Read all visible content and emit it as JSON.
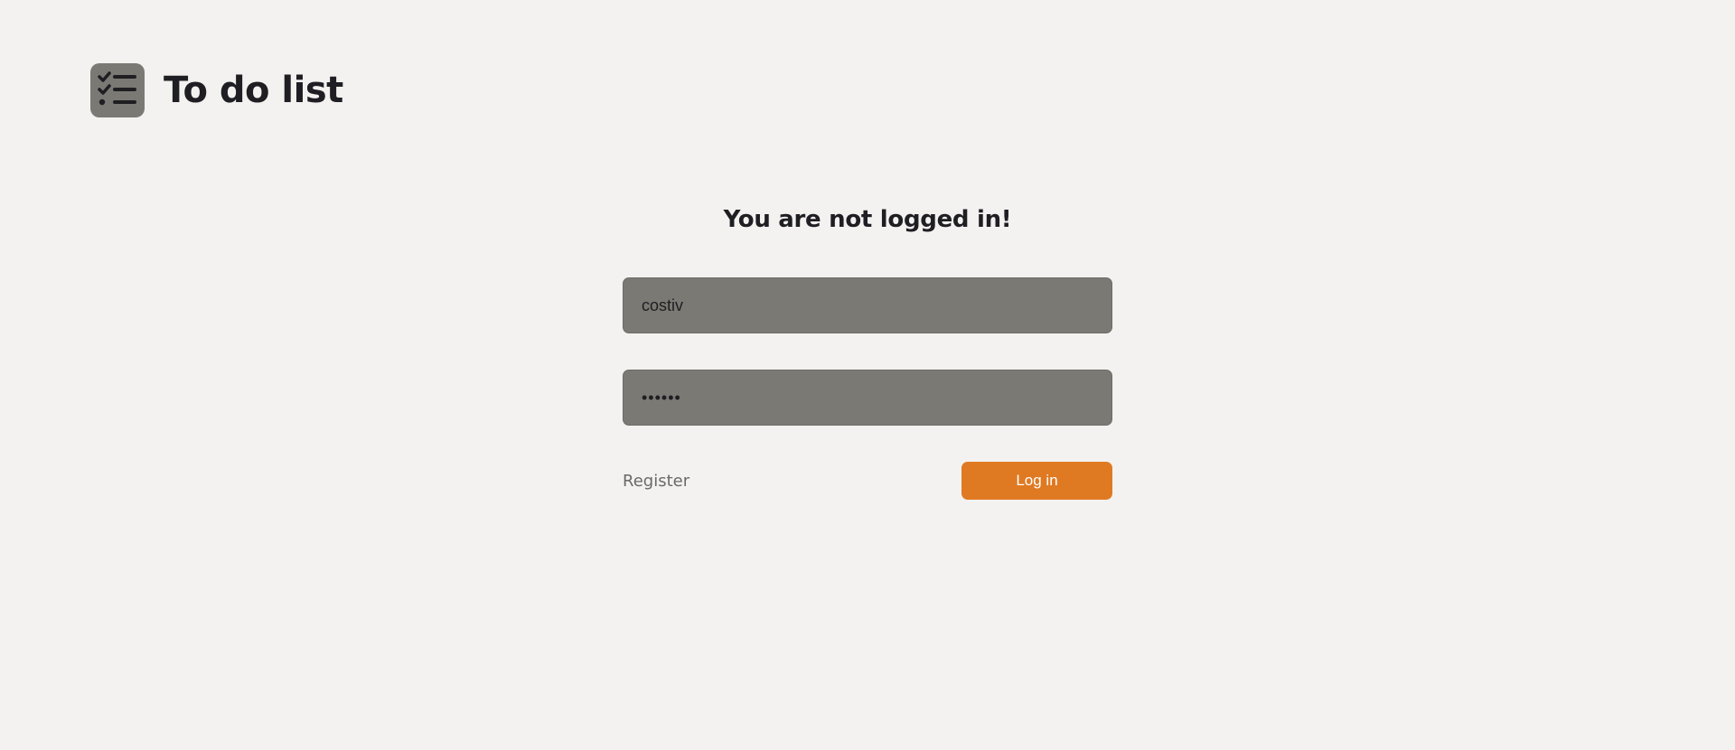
{
  "header": {
    "logo_icon": "checklist-icon",
    "title": "To do list"
  },
  "login": {
    "title": "You are not logged in!",
    "username": {
      "value": "costiv"
    },
    "password": {
      "value": "secret"
    },
    "register_label": "Register",
    "login_label": "Log in"
  },
  "colors": {
    "background": "#f3f2f1",
    "field": "#7b7974",
    "accent": "#e07a22",
    "text": "#1f1e22"
  }
}
